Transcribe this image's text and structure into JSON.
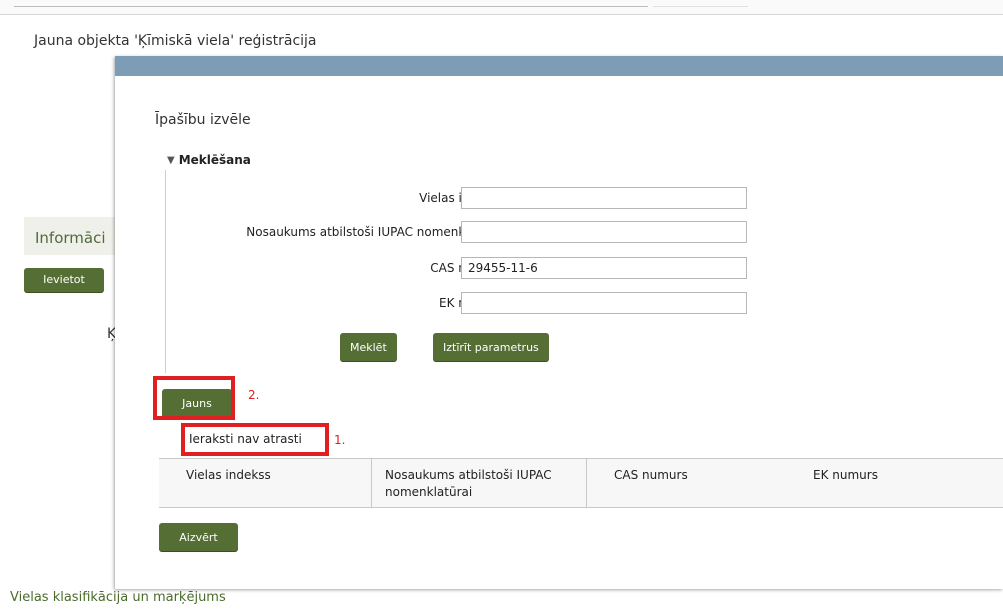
{
  "background": {
    "page_title": "Jauna objekta 'Ķīmiskā viela' reģistrācija",
    "section_label": "Informāci",
    "insert_button": "Ievietot",
    "partial_letter": "Ķ",
    "footer_text": "Vielas klasifikācija un marķējums"
  },
  "modal": {
    "title": "Īpašību izvēle",
    "search_section": "Meklēšana",
    "fields": [
      {
        "label": "Vielas indekss:",
        "value": ""
      },
      {
        "label": "Nosaukums atbilstoši IUPAC nomenklatūrai:",
        "value": ""
      },
      {
        "label": "CAS numurs:",
        "value": "29455-11-6"
      },
      {
        "label": "EK numurs:",
        "value": ""
      }
    ],
    "search_button": "Meklēt",
    "clear_button": "Iztīrīt parametrus",
    "new_button": "Jauns",
    "empty_message": "Ieraksti nav atrasti",
    "table_headers": [
      "Vielas indekss",
      "Nosaukums atbilstoši IUPAC nomenklatūrai",
      "CAS numurs",
      "EK numurs"
    ],
    "close_button": "Aizvērt"
  },
  "annotations": {
    "step1": "1.",
    "step2": "2.",
    "highlight_color": "#e02020"
  },
  "colors": {
    "button": "#556e33",
    "modal_header": "#7d9cb6",
    "section_text": "#4f6b3a"
  }
}
